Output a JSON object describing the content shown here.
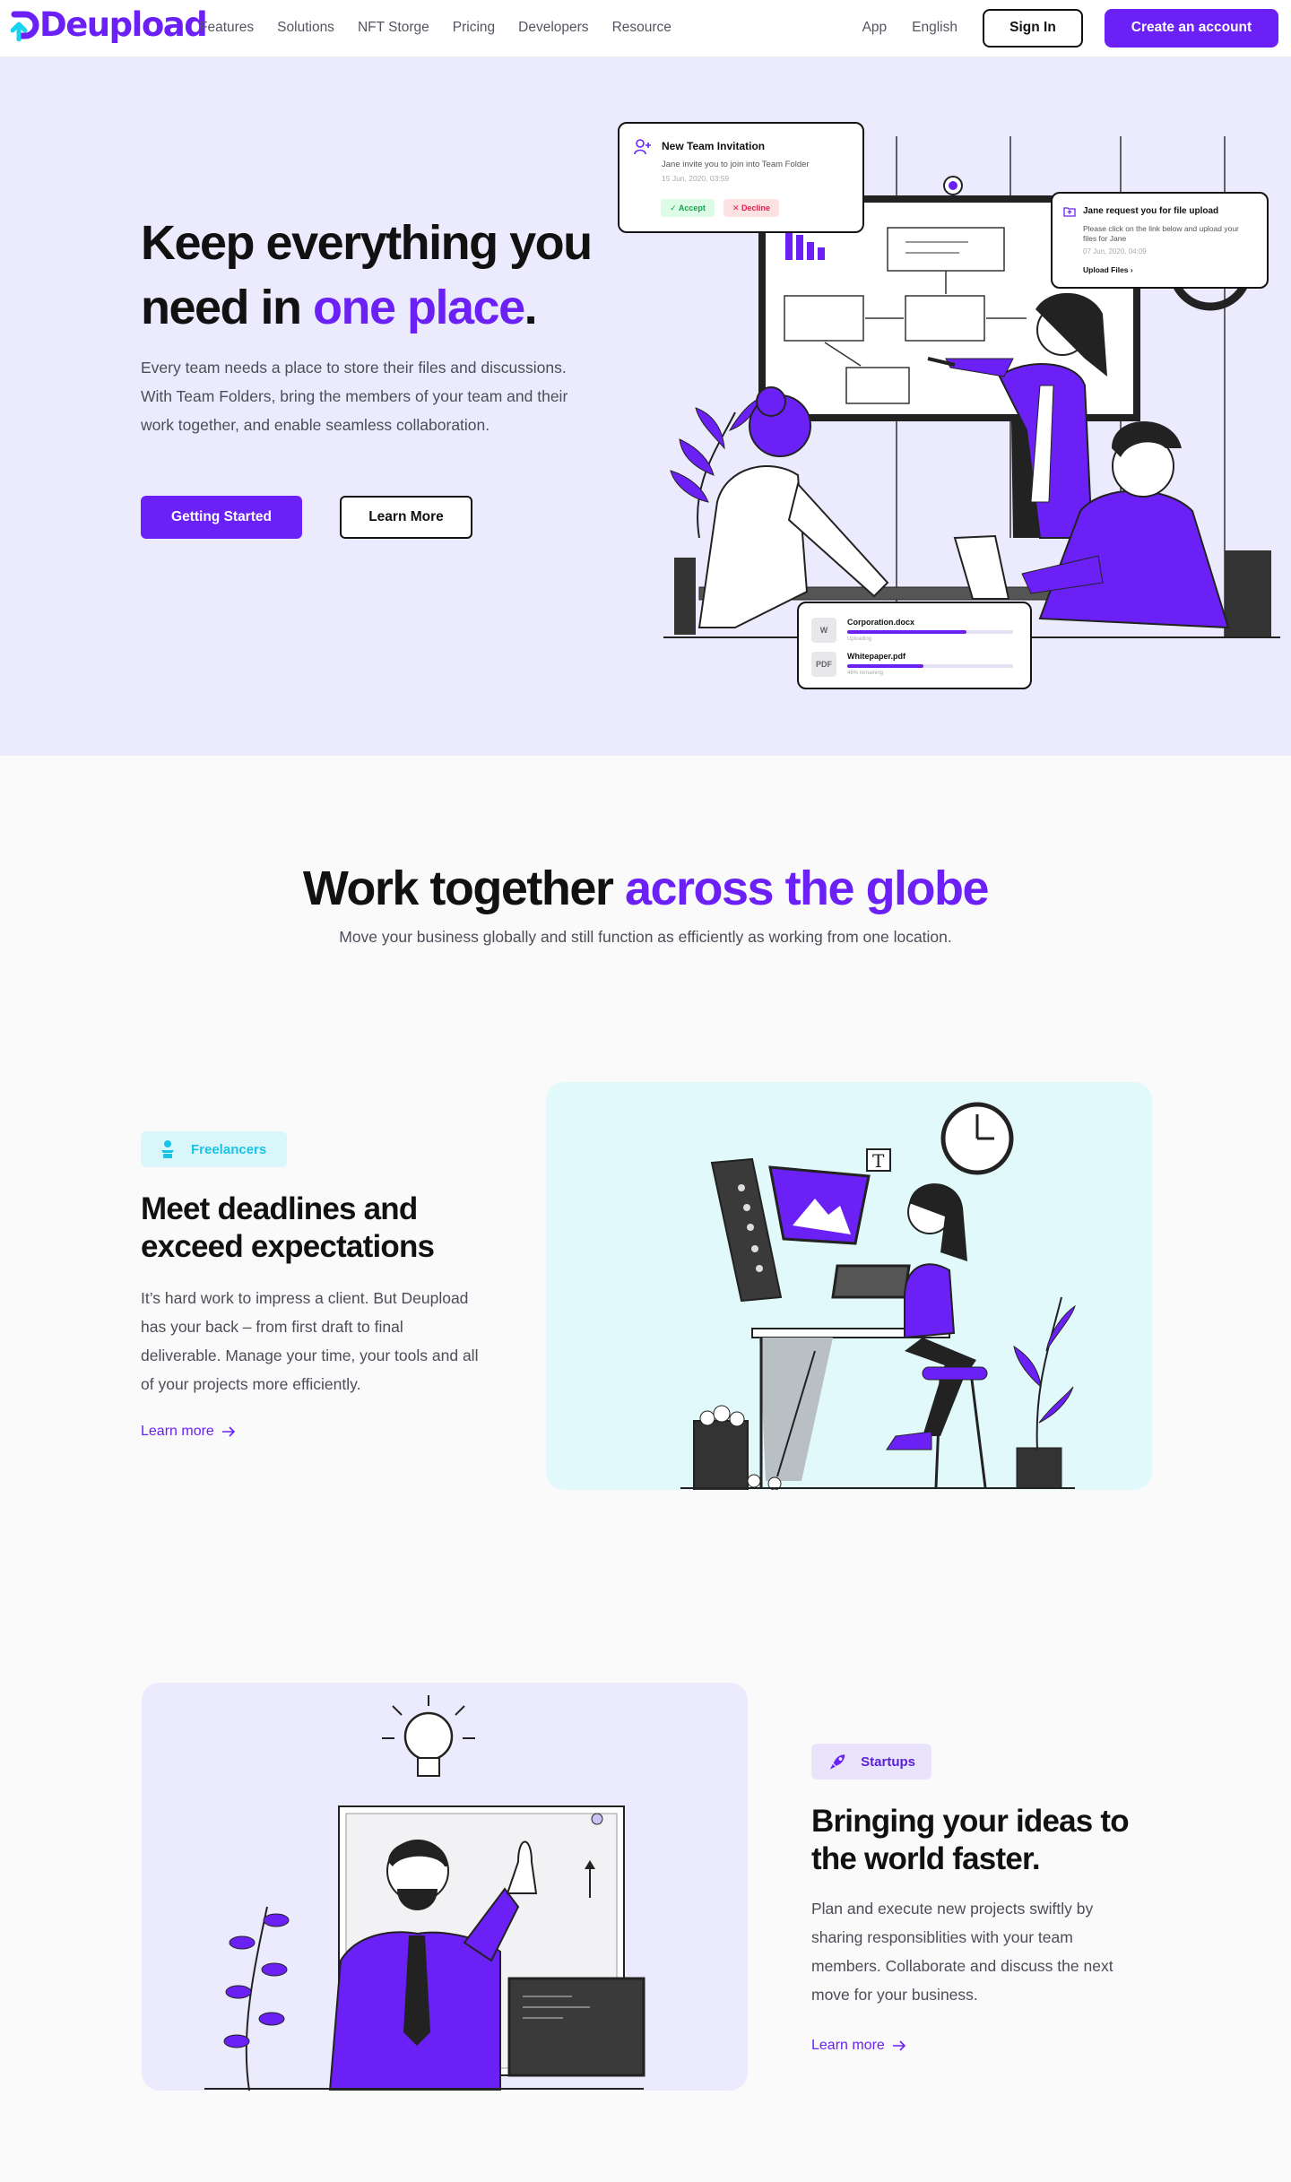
{
  "brand": {
    "name": "Deupload",
    "primary": "#6b21f5",
    "hero_bg": "#ecebfd"
  },
  "nav": {
    "links": [
      "Features",
      "Solutions",
      "NFT Storge",
      "Pricing",
      "Developers",
      "Resource"
    ],
    "app": "App",
    "language": "English",
    "signin": "Sign In",
    "create": "Create an account"
  },
  "hero": {
    "title_line1": "Keep everything you",
    "title_line2_pre": "need in ",
    "title_accent": "one place",
    "title_end": ".",
    "description": "Every team needs a place to store their files and discussions. With Team Folders, bring the members of your team and their work together, and enable seamless collaboration.",
    "primary_cta": "Getting Started",
    "secondary_cta": "Learn More",
    "invitation": {
      "title": "New Team Invitation",
      "subtitle": "Jane invite you to join into Team Folder",
      "time": "15 Jun, 2020, 03:59",
      "accept": "Accept",
      "decline": "Decline"
    },
    "request": {
      "title": "Jane request you for file upload",
      "subtitle": "Please click on the link below and upload your files for Jane",
      "time": "07 Jun, 2020, 04:09",
      "link": "Upload Files"
    },
    "files": [
      {
        "badge": "W",
        "name": "Corporation.docx",
        "meta": "Uploading",
        "progress": 0.72
      },
      {
        "badge": "PDF",
        "name": "Whitepaper.pdf",
        "meta": "46% remaining",
        "progress": 0.46
      }
    ]
  },
  "globe": {
    "title_pre": "Work together ",
    "title_accent": "across the globe",
    "subtitle": "Move your business globally and still function as efficiently as working from one location."
  },
  "freelancers": {
    "tag": "Freelancers",
    "title": "Meet deadlines and exceed expectations",
    "description": "It’s hard work to impress a client. But Deupload has your back – from first draft to final deliverable. Manage your time, your tools and all of your projects more efficiently.",
    "link": "Learn more"
  },
  "startups": {
    "tag": "Startups",
    "title": "Bringing your ideas to the world faster.",
    "description": "Plan and execute new projects swiftly by sharing responsiblities with your team members. Collaborate and discuss the next move for your business.",
    "link": "Learn more"
  }
}
